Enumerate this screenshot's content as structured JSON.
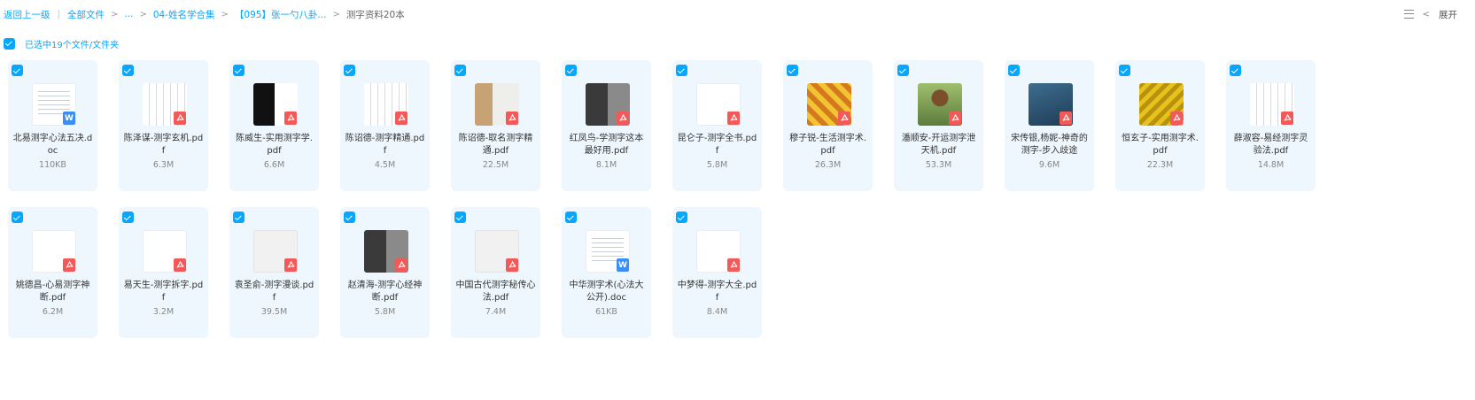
{
  "breadcrumb": {
    "back": "返回上一级",
    "all_files": "全部文件",
    "ellipsis": "...",
    "folder1": "04-姓名学合集",
    "folder2": "【095】张一勺八卦...",
    "current": "测字资料20本",
    "separator": ">"
  },
  "toolbar": {
    "expand_label": "展开"
  },
  "selection": {
    "label": "已选中19个文件/文件夹"
  },
  "colors": {
    "accent": "#06a7ff",
    "card_bg": "#eef7fe",
    "pdf_badge": "#f25a5a",
    "word_badge": "#3b8ef3"
  },
  "files": [
    {
      "name": "北易测字心法五决.doc",
      "size": "110KB",
      "type": "word",
      "thumb": "doc"
    },
    {
      "name": "陈泽谋-测字玄机.pdf",
      "size": "6.3M",
      "type": "pdf",
      "thumb": "scan"
    },
    {
      "name": "陈威生-实用测字学.pdf",
      "size": "6.6M",
      "type": "pdf",
      "thumb": "dark"
    },
    {
      "name": "陈诏德-测字精通.pdf",
      "size": "4.5M",
      "type": "pdf",
      "thumb": "scan"
    },
    {
      "name": "陈诏德-取名测字精通.pdf",
      "size": "22.5M",
      "type": "pdf",
      "thumb": "tan"
    },
    {
      "name": "红凤鸟-学测字这本最好用.pdf",
      "size": "8.1M",
      "type": "pdf",
      "thumb": "dark2"
    },
    {
      "name": "昆仑子-测字全书.pdf",
      "size": "5.8M",
      "type": "pdf",
      "thumb": "white"
    },
    {
      "name": "穆子锐-生活测字术.pdf",
      "size": "26.3M",
      "type": "pdf",
      "thumb": "red"
    },
    {
      "name": "潘顺安-开运测字泄天机.pdf",
      "size": "53.3M",
      "type": "pdf",
      "thumb": "green"
    },
    {
      "name": "宋传银,杨妮-神奇的测字-步入歧途",
      "size": "9.6M",
      "type": "pdf",
      "thumb": "blue"
    },
    {
      "name": "恒玄子-实用测字术.pdf",
      "size": "22.3M",
      "type": "pdf",
      "thumb": "gold"
    },
    {
      "name": "薛淑容-易经测字灵验法.pdf",
      "size": "14.8M",
      "type": "pdf",
      "thumb": "scan"
    },
    {
      "name": "姚德昌-心易测字神断.pdf",
      "size": "6.2M",
      "type": "pdf",
      "thumb": "white"
    },
    {
      "name": "易天生-测字拆字.pdf",
      "size": "3.2M",
      "type": "pdf",
      "thumb": "white"
    },
    {
      "name": "袁圣俞-测字漫谈.pdf",
      "size": "39.5M",
      "type": "pdf",
      "thumb": "gray"
    },
    {
      "name": "赵清海-测字心经神断.pdf",
      "size": "5.8M",
      "type": "pdf",
      "thumb": "dark2"
    },
    {
      "name": "中国古代测字秘传心法.pdf",
      "size": "7.4M",
      "type": "pdf",
      "thumb": "gray"
    },
    {
      "name": "中华测字术(心法大公开).doc",
      "size": "61KB",
      "type": "word",
      "thumb": "doc"
    },
    {
      "name": "中梦得-测字大全.pdf",
      "size": "8.4M",
      "type": "pdf",
      "thumb": "white"
    }
  ]
}
